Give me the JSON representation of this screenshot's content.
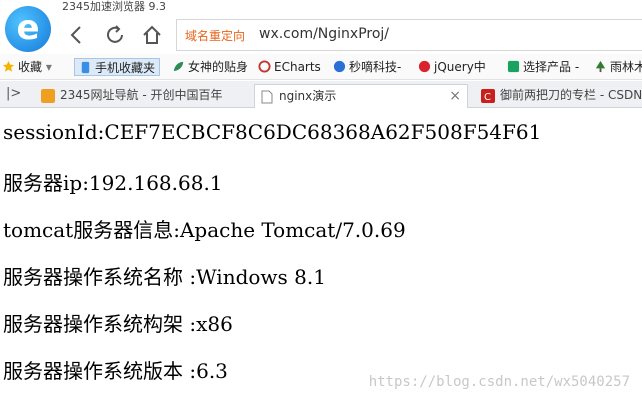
{
  "browser": {
    "title": "2345加速浏览器 9.3",
    "redirect_label": "域名重定向",
    "url": "wx.com/NginxProj/",
    "logo_letter": "e"
  },
  "bookmarks": [
    {
      "label": "收藏",
      "icon": "star-icon"
    },
    {
      "label": "手机收藏夹",
      "icon": "phone-icon"
    },
    {
      "label": "女神的贴身",
      "icon": "leaf-icon"
    },
    {
      "label": "ECharts",
      "icon": "echarts-icon"
    },
    {
      "label": "秒嘀科技-",
      "icon": "bird-icon"
    },
    {
      "label": "jQuery中",
      "icon": "jquery-icon"
    },
    {
      "label": "选择产品 -",
      "icon": "c-icon"
    },
    {
      "label": "雨林木",
      "icon": "tree-icon"
    }
  ],
  "tabs": [
    {
      "label": "2345网址导航 - 开创中国百年",
      "icon": "2345-icon"
    },
    {
      "label": "nginx演示",
      "icon": "page-icon",
      "close": "×"
    },
    {
      "label": "御前两把刀的专栏 - CSDN",
      "icon": "csdn-icon"
    }
  ],
  "content": {
    "lines": [
      "sessionId:CEF7ECBCF8C6DC68368A62F508F54F61",
      "服务器ip:192.168.68.1",
      "tomcat服务器信息:Apache Tomcat/7.0.69",
      "服务器操作系统名称 :Windows 8.1",
      "服务器操作系统构架 :x86",
      "服务器操作系统版本 :6.3"
    ],
    "watermark": "https://blog.csdn.net/wx5040257"
  },
  "colors": {
    "redirect": "#e8641b",
    "logo": "#1479d9",
    "tab_active_bg": "#ffffff"
  }
}
